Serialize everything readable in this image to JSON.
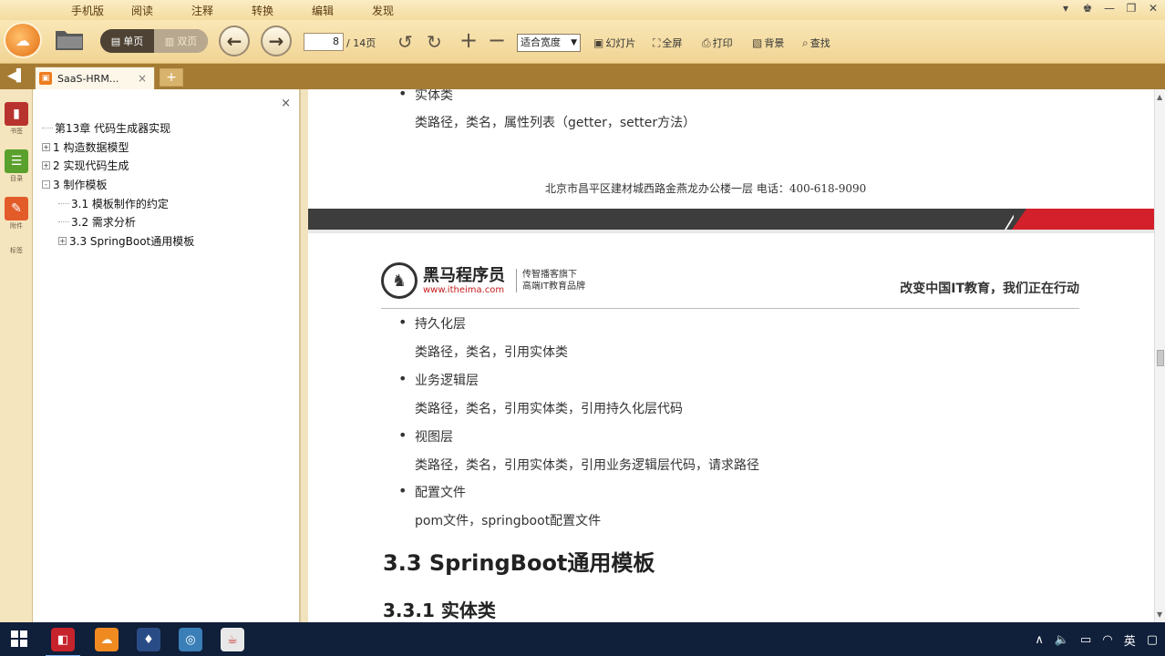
{
  "menu": [
    "手机版",
    "阅读",
    "注释",
    "转换",
    "编辑",
    "发现"
  ],
  "toolbar": {
    "single_page": "单页",
    "double_page": "双页",
    "current_page": "8",
    "total_pages": "/ 14页",
    "zoom": "适合宽度",
    "slideshow": "幻灯片",
    "fullscreen": "全屏",
    "print": "打印",
    "background": "背景",
    "find": "查找"
  },
  "tabs": [
    {
      "label": "SaaS-HRM..."
    }
  ],
  "rail": [
    "书签",
    "目录",
    "附件",
    "标签"
  ],
  "outline": [
    {
      "label": "第13章 代码生成器实现",
      "level": 0,
      "expander": ""
    },
    {
      "label": "1 构造数据模型",
      "level": 0,
      "expander": "+"
    },
    {
      "label": "2 实现代码生成",
      "level": 0,
      "expander": "+"
    },
    {
      "label": "3 制作模板",
      "level": 0,
      "expander": "-"
    },
    {
      "label": "3.1 模板制作的约定",
      "level": 1,
      "expander": ""
    },
    {
      "label": "3.2 需求分析",
      "level": 1,
      "expander": ""
    },
    {
      "label": "3.3 SpringBoot通用模板",
      "level": 1,
      "expander": "+"
    }
  ],
  "document": {
    "entity_item": "实体类",
    "entity_desc": "类路径，类名，属性列表（getter，setter方法）",
    "footer_address": "北京市昌平区建材城西路金燕龙办公楼一层    电话：400-618-9090",
    "brand_name": "黑马程序员",
    "brand_url": "www.itheima.com",
    "brand_slogan_1": "传智播客旗下",
    "brand_slogan_2": "高端IT教育品牌",
    "tagline": "改变中国IT教育，我们正在行动",
    "items": [
      {
        "title": "持久化层",
        "desc": "类路径，类名，引用实体类"
      },
      {
        "title": "业务逻辑层",
        "desc": "类路径，类名，引用实体类，引用持久化层代码"
      },
      {
        "title": "视图层",
        "desc": "类路径，类名，引用实体类，引用业务逻辑层代码，请求路径"
      },
      {
        "title": "配置文件",
        "desc": "pom文件，springboot配置文件"
      }
    ],
    "heading_2": "3.3 SpringBoot通用模板",
    "heading_3": "3.3.1 实体类"
  },
  "tray": {
    "ime": "英"
  },
  "colors": {
    "toolbar": "#f4dca0",
    "tabstrip": "#a57b34",
    "taskbar": "#101f3a",
    "accent_red": "#d3202a"
  }
}
